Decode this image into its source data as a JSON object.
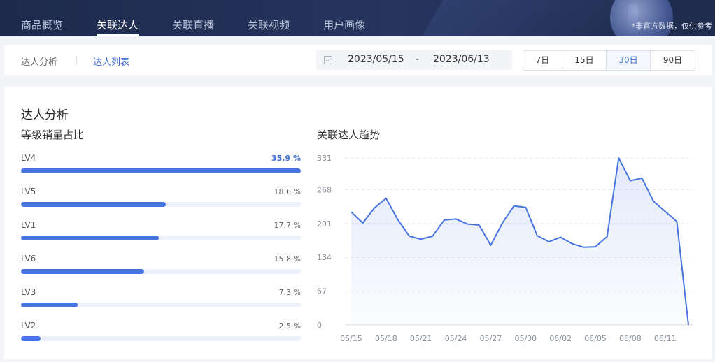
{
  "header": {
    "tabs": [
      {
        "label": "商品概览"
      },
      {
        "label": "关联达人"
      },
      {
        "label": "关联直播"
      },
      {
        "label": "关联视频"
      },
      {
        "label": "用户画像"
      }
    ],
    "active_tab": 1,
    "note": "*非官方数据，仅供参考"
  },
  "filter": {
    "subtabs": [
      {
        "label": "达人分析"
      },
      {
        "label": "达人列表"
      }
    ],
    "active_subtab": 1,
    "date_start": "2023/05/15",
    "date_separator": "-",
    "date_end": "2023/06/13",
    "periods": [
      {
        "label": "7日"
      },
      {
        "label": "15日"
      },
      {
        "label": "30日"
      },
      {
        "label": "90日"
      }
    ],
    "active_period": 2,
    "icon": "calendar-icon"
  },
  "analysis": {
    "title": "达人分析",
    "level_title": "等级销量占比",
    "levels": [
      {
        "label": "LV4",
        "percent_text": "35.9 %",
        "value": 35.9
      },
      {
        "label": "LV5",
        "percent_text": "18.6 %",
        "value": 18.6
      },
      {
        "label": "LV1",
        "percent_text": "17.7 %",
        "value": 17.7
      },
      {
        "label": "LV6",
        "percent_text": "15.8 %",
        "value": 15.8
      },
      {
        "label": "LV3",
        "percent_text": "7.3 %",
        "value": 7.3
      },
      {
        "label": "LV2",
        "percent_text": "2.5 %",
        "value": 2.5
      }
    ],
    "trend_title": "关联达人趋势"
  },
  "colors": {
    "accent": "#3f6fd8",
    "bar_fill": "#4774e0",
    "bar_track": "#edf1fb",
    "header_bg": "#1f2b4d",
    "line": "#4774e0"
  },
  "chart_data": {
    "type": "area",
    "title": "",
    "xlabel": "",
    "ylabel": "",
    "ylim": [
      0,
      331
    ],
    "yticks": [
      0,
      67,
      134,
      201,
      268,
      331
    ],
    "xticks": [
      "05/15",
      "05/18",
      "05/21",
      "05/24",
      "05/27",
      "05/30",
      "06/02",
      "06/05",
      "06/08",
      "06/11"
    ],
    "grid": true,
    "legend": "none",
    "x": [
      "05/15",
      "05/16",
      "05/17",
      "05/18",
      "05/19",
      "05/20",
      "05/21",
      "05/22",
      "05/23",
      "05/24",
      "05/25",
      "05/26",
      "05/27",
      "05/28",
      "05/29",
      "05/30",
      "05/31",
      "06/01",
      "06/02",
      "06/03",
      "06/04",
      "06/05",
      "06/06",
      "06/07",
      "06/08",
      "06/09",
      "06/10",
      "06/11",
      "06/12",
      "06/13"
    ],
    "series": [
      {
        "values": [
          224,
          202,
          232,
          251,
          209,
          176,
          170,
          176,
          208,
          210,
          200,
          198,
          158,
          202,
          236,
          233,
          177,
          165,
          174,
          161,
          154,
          155,
          175,
          331,
          286,
          291,
          245,
          225,
          205,
          0
        ]
      }
    ]
  }
}
